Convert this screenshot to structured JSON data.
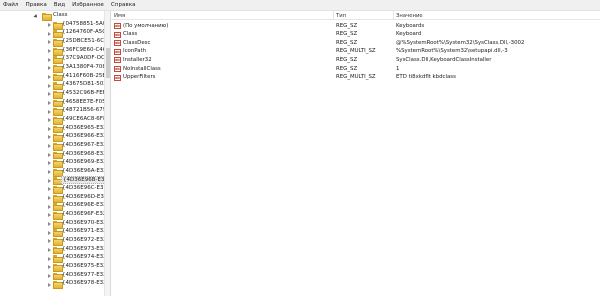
{
  "menu": [
    "Файл",
    "Правка",
    "Вид",
    "Избранное",
    "Справка"
  ],
  "tree": {
    "root": "Class",
    "items": [
      "{04758851-5A0",
      "{1264760F-A5C",
      "{25DBCE51-6C8",
      "{36FC9E60-C46",
      "{37C9A0DF-OC",
      "{3A1380F4-708",
      "{4116F60B-25E",
      "{43675D81-502",
      "{4532C96B-FEFC",
      "{4658EE7E-F05C",
      "{48721B56-679",
      "{49CE6AC8-6F8",
      "{4D36E965-E32",
      "{4D36E966-E32",
      "{4D36E967-E32",
      "{4D36E968-E32",
      "{4D36E969-E32",
      "{4D36E96A-E32",
      "{4D36E96B-E32",
      "{4D36E96C-E32",
      "{4D36E96D-E32",
      "{4D36E96E-E327",
      "{4D36E96F-E32",
      "{4D36E970-E32",
      "{4D36E971-E32",
      "{4D36E972-E32",
      "{4D36E973-E32",
      "{4D36E974-E32",
      "{4D36E975-E32",
      "{4D36E977-E32",
      "{4D36E978-E32"
    ],
    "selected_index": 18
  },
  "list": {
    "columns": [
      "Имя",
      "Тип",
      "Значение"
    ],
    "rows": [
      {
        "name": "(По умолчанию)",
        "type": "REG_SZ",
        "value": "Keyboards"
      },
      {
        "name": "Class",
        "type": "REG_SZ",
        "value": "Keyboard"
      },
      {
        "name": "ClassDesc",
        "type": "REG_SZ",
        "value": "@%SystemRoot%\\System32\\SysClass.Dll,-3002"
      },
      {
        "name": "IconPath",
        "type": "REG_MULTI_SZ",
        "value": "%SystemRoot%\\System32\\setupapi.dll,-3"
      },
      {
        "name": "Installer32",
        "type": "REG_SZ",
        "value": "SysClass.Dll,KeyboardClassInstaller"
      },
      {
        "name": "NoInstallClass",
        "type": "REG_SZ",
        "value": "1"
      },
      {
        "name": "UpperFilters",
        "type": "REG_MULTI_SZ",
        "value": "ETD ti8xkdflt kbdclass"
      }
    ],
    "icon_label": "ab"
  }
}
